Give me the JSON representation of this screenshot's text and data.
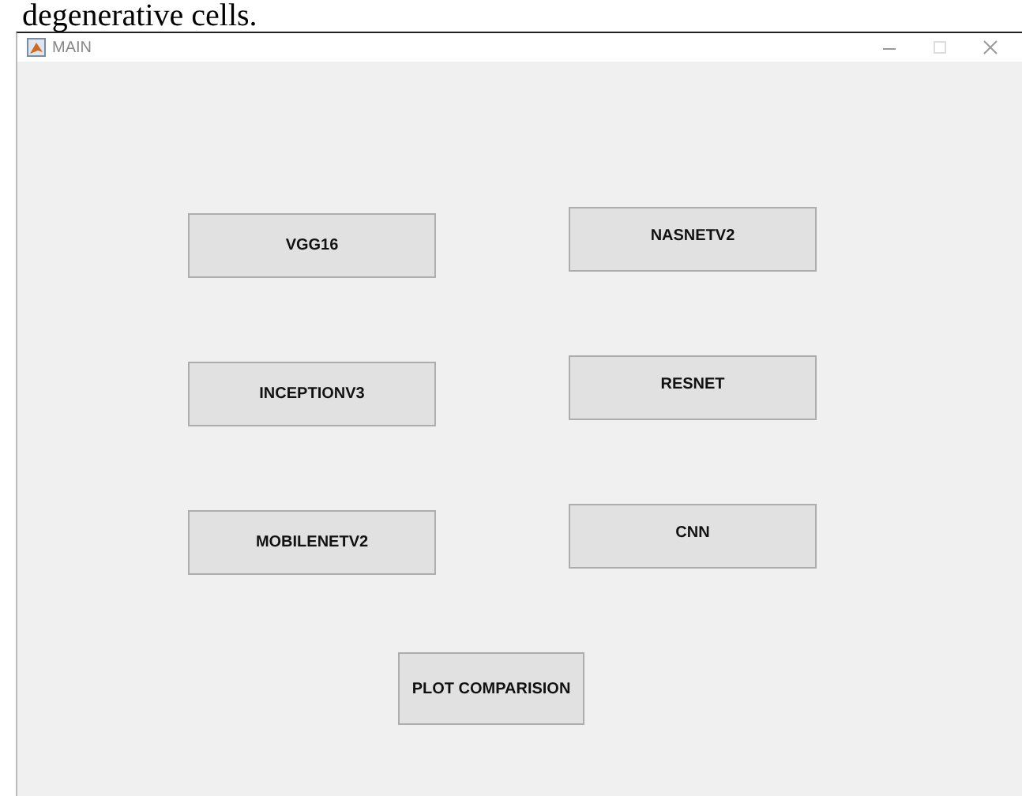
{
  "caption": "degenerative cells.",
  "window": {
    "title": "MAIN"
  },
  "buttons": [
    {
      "label": "VGG16"
    },
    {
      "label": "NASNETV2"
    },
    {
      "label": "INCEPTIONV3"
    },
    {
      "label": "RESNET"
    },
    {
      "label": "MOBILENETV2"
    },
    {
      "label": "CNN"
    }
  ],
  "action_button": {
    "label": "PLOT COMPARISION"
  }
}
